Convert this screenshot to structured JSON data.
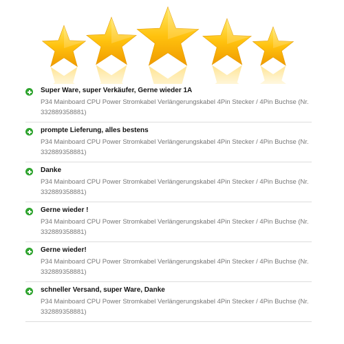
{
  "rating": {
    "stars_filled": 5,
    "stars_total": 5,
    "star_color": "#f4b800",
    "star_highlight": "#ffe45c"
  },
  "feedback": [
    {
      "type": "positive",
      "comment": "Super Ware, super Verkäufer, Gerne wieder 1A",
      "item": "P34 Mainboard CPU Power Stromkabel Verlängerungskabel 4Pin Stecker / 4Pin Buchse (Nr. 332889358881)"
    },
    {
      "type": "positive",
      "comment": "prompte Lieferung, alles bestens",
      "item": "P34 Mainboard CPU Power Stromkabel Verlängerungskabel 4Pin Stecker / 4Pin Buchse (Nr. 332889358881)"
    },
    {
      "type": "positive",
      "comment": "Danke",
      "item": "P34 Mainboard CPU Power Stromkabel Verlängerungskabel 4Pin Stecker / 4Pin Buchse (Nr. 332889358881)"
    },
    {
      "type": "positive",
      "comment": "Gerne wieder !",
      "item": "P34 Mainboard CPU Power Stromkabel Verlängerungskabel 4Pin Stecker / 4Pin Buchse (Nr. 332889358881)"
    },
    {
      "type": "positive",
      "comment": "Gerne wieder!",
      "item": "P34 Mainboard CPU Power Stromkabel Verlängerungskabel 4Pin Stecker / 4Pin Buchse (Nr. 332889358881)"
    },
    {
      "type": "positive",
      "comment": "schneller Versand, super Ware, Danke",
      "item": "P34 Mainboard CPU Power Stromkabel Verlängerungskabel 4Pin Stecker / 4Pin Buchse (Nr. 332889358881)"
    }
  ],
  "colors": {
    "positive_icon": "#2fa42f",
    "divider": "#dcdcdc",
    "comment_text": "#111111",
    "item_text": "#777777"
  }
}
